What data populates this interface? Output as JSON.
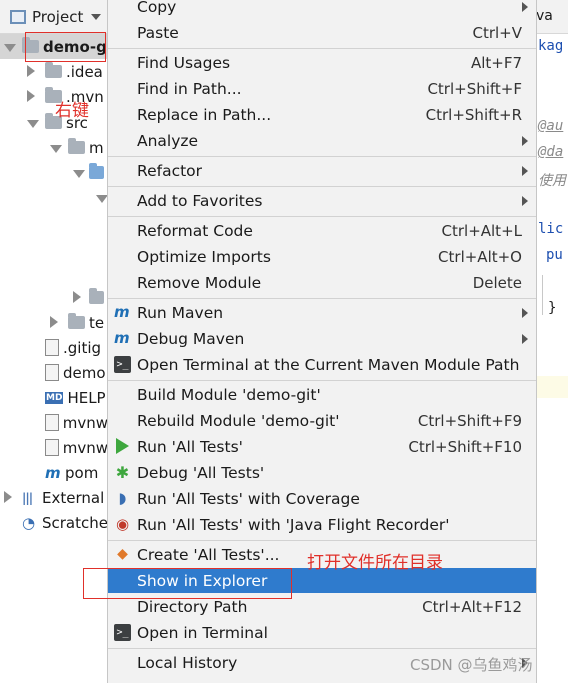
{
  "panel": {
    "title": "Project",
    "tree": [
      {
        "label": "demo-g",
        "indent": 0,
        "arrow": "down",
        "icon": "module-folder",
        "selected": true,
        "bold": true
      },
      {
        "label": ".idea",
        "indent": 1,
        "arrow": "right",
        "icon": "folder"
      },
      {
        "label": ".mvn",
        "indent": 1,
        "arrow": "right",
        "icon": "folder"
      },
      {
        "label": "src",
        "indent": 1,
        "arrow": "down",
        "icon": "folder"
      },
      {
        "label": "m",
        "indent": 2,
        "arrow": "down",
        "icon": "folder"
      },
      {
        "label": "",
        "indent": 3,
        "arrow": "down",
        "icon": "folder-blue"
      },
      {
        "label": "",
        "indent": 4,
        "arrow": "down",
        "icon": ""
      },
      {
        "label": "",
        "indent": 3,
        "arrow": "right",
        "icon": "folder"
      },
      {
        "label": "te",
        "indent": 2,
        "arrow": "right",
        "icon": "folder"
      },
      {
        "label": ".gitig",
        "indent": 1,
        "arrow": "",
        "icon": "gitignore-file"
      },
      {
        "label": "demo",
        "indent": 1,
        "arrow": "",
        "icon": "file"
      },
      {
        "label": "HELP",
        "indent": 1,
        "arrow": "",
        "icon": "md-file"
      },
      {
        "label": "mvnw",
        "indent": 1,
        "arrow": "",
        "icon": "script-file"
      },
      {
        "label": "mvnw",
        "indent": 1,
        "arrow": "",
        "icon": "script-file"
      },
      {
        "label": "pom",
        "indent": 1,
        "arrow": "",
        "icon": "maven-file"
      },
      {
        "label": "External",
        "indent": 0,
        "arrow": "right",
        "icon": "library"
      },
      {
        "label": "Scratche",
        "indent": 0,
        "arrow": "",
        "icon": "scratch"
      }
    ]
  },
  "editor": {
    "tab": "va",
    "lines": [
      {
        "text": "kag",
        "style": "blue"
      },
      {
        "text": "@au",
        "style": "anno"
      },
      {
        "text": "@da",
        "style": "anno"
      },
      {
        "text": "使用",
        "style": "ital"
      },
      {
        "text": "lic",
        "style": "blue"
      },
      {
        "text": "pu",
        "style": "blue"
      },
      {
        "text": "}",
        "style": "plain"
      }
    ]
  },
  "menu": {
    "items": [
      {
        "label": "Copy",
        "shortcut": "",
        "submenu": true,
        "icon": ""
      },
      {
        "label": "Paste",
        "shortcut": "Ctrl+V",
        "submenu": false,
        "icon": "paste-icon"
      },
      {
        "sep": true
      },
      {
        "label": "Find Usages",
        "shortcut": "Alt+F7",
        "submenu": false,
        "icon": ""
      },
      {
        "label": "Find in Path...",
        "shortcut": "Ctrl+Shift+F",
        "submenu": false,
        "icon": ""
      },
      {
        "label": "Replace in Path...",
        "shortcut": "Ctrl+Shift+R",
        "submenu": false,
        "icon": ""
      },
      {
        "label": "Analyze",
        "shortcut": "",
        "submenu": true,
        "icon": ""
      },
      {
        "sep": true
      },
      {
        "label": "Refactor",
        "shortcut": "",
        "submenu": true,
        "icon": ""
      },
      {
        "sep": true
      },
      {
        "label": "Add to Favorites",
        "shortcut": "",
        "submenu": true,
        "icon": ""
      },
      {
        "sep": true
      },
      {
        "label": "Reformat Code",
        "shortcut": "Ctrl+Alt+L",
        "submenu": false,
        "icon": ""
      },
      {
        "label": "Optimize Imports",
        "shortcut": "Ctrl+Alt+O",
        "submenu": false,
        "icon": ""
      },
      {
        "label": "Remove Module",
        "shortcut": "Delete",
        "submenu": false,
        "icon": ""
      },
      {
        "sep": true
      },
      {
        "label": "Run Maven",
        "shortcut": "",
        "submenu": true,
        "icon": "maven-icon"
      },
      {
        "label": "Debug Maven",
        "shortcut": "",
        "submenu": true,
        "icon": "maven-debug-icon"
      },
      {
        "label": "Open Terminal at the Current Maven Module Path",
        "shortcut": "",
        "submenu": false,
        "icon": "terminal-maven-icon"
      },
      {
        "sep": true
      },
      {
        "label": "Build Module 'demo-git'",
        "shortcut": "",
        "submenu": false,
        "icon": ""
      },
      {
        "label": "Rebuild Module 'demo-git'",
        "shortcut": "Ctrl+Shift+F9",
        "submenu": false,
        "icon": ""
      },
      {
        "label": "Run 'All Tests'",
        "shortcut": "Ctrl+Shift+F10",
        "submenu": false,
        "icon": "run-icon"
      },
      {
        "label": "Debug 'All Tests'",
        "shortcut": "",
        "submenu": false,
        "icon": "debug-icon"
      },
      {
        "label": "Run 'All Tests' with Coverage",
        "shortcut": "",
        "submenu": false,
        "icon": "coverage-icon"
      },
      {
        "label": "Run 'All Tests' with 'Java Flight Recorder'",
        "shortcut": "",
        "submenu": false,
        "icon": "flight-recorder-icon"
      },
      {
        "sep": true
      },
      {
        "label": "Create 'All Tests'...",
        "shortcut": "",
        "submenu": false,
        "icon": "create-config-icon"
      },
      {
        "label": "Show in Explorer",
        "shortcut": "",
        "submenu": false,
        "icon": "",
        "hover": true
      },
      {
        "label": "Directory Path",
        "shortcut": "Ctrl+Alt+F12",
        "submenu": false,
        "icon": ""
      },
      {
        "label": "Open in Terminal",
        "shortcut": "",
        "submenu": false,
        "icon": "terminal-icon"
      },
      {
        "sep": true
      },
      {
        "label": "Local History",
        "shortcut": "",
        "submenu": true,
        "icon": ""
      }
    ]
  },
  "annotations": {
    "right_click_label": "右键",
    "open_folder_label": "打开文件所在目录",
    "accent_color": "#e0302a"
  },
  "watermark": "CSDN @乌鱼鸡汤"
}
